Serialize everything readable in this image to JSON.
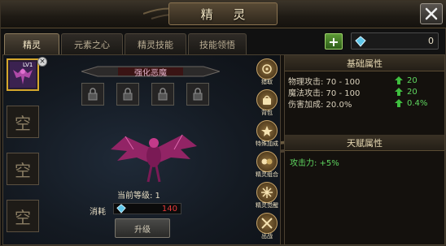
{
  "window": {
    "title": "精 灵"
  },
  "tabs": [
    {
      "label": "精灵",
      "active": true
    },
    {
      "label": "元素之心",
      "active": false
    },
    {
      "label": "精灵技能",
      "active": false
    },
    {
      "label": "技能领悟",
      "active": false
    }
  ],
  "currency": {
    "icon": "diamond-icon",
    "value": "0"
  },
  "slots": [
    {
      "level": "LV1",
      "selected": true
    },
    {
      "label": "空"
    },
    {
      "label": "空"
    },
    {
      "label": "空"
    }
  ],
  "spirit": {
    "name": "强化恶魔",
    "current_level": "当前等级: 1",
    "consume_label": "消耗",
    "consume_value": "140",
    "upgrade_label": "升级"
  },
  "side_buttons": [
    {
      "label": "猎取",
      "icon": "hunt-icon"
    },
    {
      "label": "背包",
      "icon": "bag-icon"
    },
    {
      "label": "特殊加成",
      "icon": "bonus-icon"
    },
    {
      "label": "精灵组合",
      "icon": "combo-icon"
    },
    {
      "label": "精灵觉醒",
      "icon": "awaken-icon"
    },
    {
      "label": "出战",
      "icon": "battle-icon"
    }
  ],
  "base_attributes": {
    "title": "基础属性",
    "rows": [
      {
        "name": "物理攻击: 70 - 100",
        "increase": "20"
      },
      {
        "name": "魔法攻击: 70 - 100",
        "increase": "20"
      },
      {
        "name": "伤害加成: 20.0%",
        "increase": "0.4%"
      }
    ]
  },
  "talent_attributes": {
    "title": "天赋属性",
    "rows": [
      "攻击力: +5%"
    ]
  },
  "colors": {
    "accent_gold": "#d4a72c",
    "increase_green": "#5fd65f",
    "consume_red": "#e43a3a"
  }
}
